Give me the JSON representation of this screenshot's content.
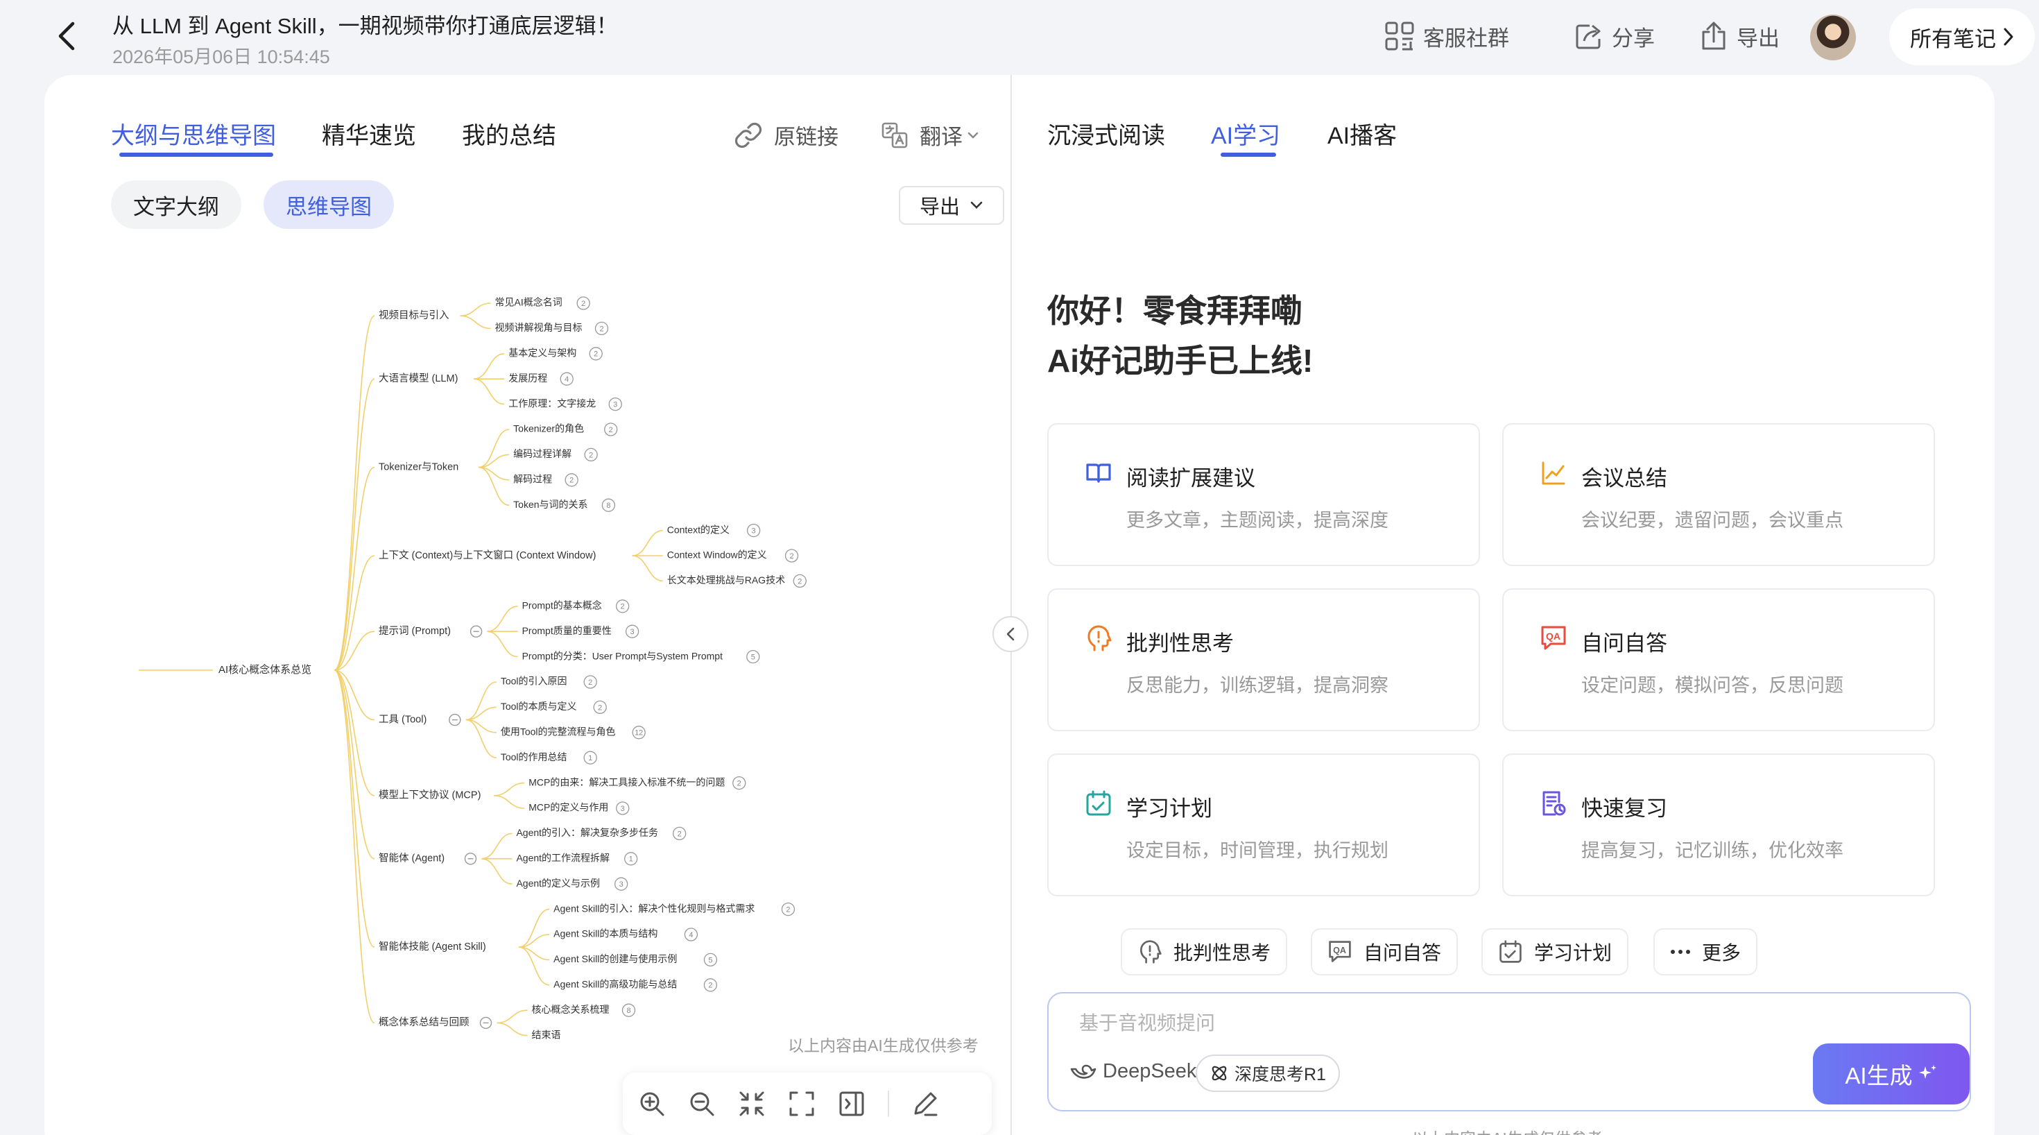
{
  "header": {
    "title": "从 LLM 到 Agent Skill，一期视频带你打通底层逻辑！",
    "datetime": "2026年05月06日 10:54:45",
    "community_label": "客服社群",
    "share_label": "分享",
    "export_label": "导出",
    "all_notes_label": "所有笔记",
    "icons": {
      "back": "chevron-left-icon",
      "community": "grid-icon",
      "share": "share-icon",
      "export": "upload-icon"
    }
  },
  "left": {
    "tabs": [
      {
        "label": "大纲与思维导图"
      },
      {
        "label": "精华速览"
      },
      {
        "label": "我的总结"
      }
    ],
    "link_label": "原链接",
    "translate_label": "翻译",
    "view_tabs": [
      {
        "label": "文字大纲"
      },
      {
        "label": "思维导图"
      }
    ],
    "export_label": "导出",
    "disclaimer": "以上内容由AI生成仅供参考",
    "mindmap": {
      "root": "AI核心概念体系总览",
      "branches": [
        {
          "label": "视频目标与引入",
          "children": [
            {
              "label": "常见AI概念名词",
              "n": "2"
            },
            {
              "label": "视频讲解视角与目标",
              "n": "2"
            }
          ]
        },
        {
          "label": "大语言模型 (LLM)",
          "children": [
            {
              "label": "基本定义与架构",
              "n": "2"
            },
            {
              "label": "发展历程",
              "n": "4"
            },
            {
              "label": "工作原理：文字接龙",
              "n": "3"
            }
          ]
        },
        {
          "label": "Tokenizer与Token",
          "children": [
            {
              "label": "Tokenizer的角色",
              "n": "2"
            },
            {
              "label": "编码过程详解",
              "n": "2"
            },
            {
              "label": "解码过程",
              "n": "2"
            },
            {
              "label": "Token与词的关系",
              "n": "8"
            }
          ]
        },
        {
          "label": "上下文 (Context)与上下文窗口 (Context Window)",
          "children": [
            {
              "label": "Context的定义",
              "n": "3"
            },
            {
              "label": "Context Window的定义",
              "n": "2"
            },
            {
              "label": "长文本处理挑战与RAG技术",
              "n": "2"
            }
          ]
        },
        {
          "label": "提示词 (Prompt)",
          "children": [
            {
              "label": "Prompt的基本概念",
              "n": "2"
            },
            {
              "label": "Prompt质量的重要性",
              "n": "3"
            },
            {
              "label": "Prompt的分类：User Prompt与System Prompt",
              "n": "5"
            }
          ]
        },
        {
          "label": "工具 (Tool)",
          "children": [
            {
              "label": "Tool的引入原因",
              "n": "2"
            },
            {
              "label": "Tool的本质与定义",
              "n": "2"
            },
            {
              "label": "使用Tool的完整流程与角色",
              "n": "12"
            },
            {
              "label": "Tool的作用总结",
              "n": "1"
            }
          ]
        },
        {
          "label": "模型上下文协议 (MCP)",
          "children": [
            {
              "label": "MCP的由来：解决工具接入标准不统一的问题",
              "n": "2"
            },
            {
              "label": "MCP的定义与作用",
              "n": "3"
            }
          ]
        },
        {
          "label": "智能体 (Agent)",
          "children": [
            {
              "label": "Agent的引入：解决复杂多步任务",
              "n": "2"
            },
            {
              "label": "Agent的工作流程拆解",
              "n": "1"
            },
            {
              "label": "Agent的定义与示例",
              "n": "3"
            }
          ]
        },
        {
          "label": "智能体技能 (Agent Skill)",
          "children": [
            {
              "label": "Agent Skill的引入：解决个性化规则与格式需求",
              "n": "2"
            },
            {
              "label": "Agent Skill的本质与结构",
              "n": "4"
            },
            {
              "label": "Agent Skill的创建与使用示例",
              "n": "5"
            },
            {
              "label": "Agent Skill的高级功能与总结",
              "n": "2"
            }
          ]
        },
        {
          "label": "概念体系总结与回顾",
          "children": [
            {
              "label": "核心概念关系梳理",
              "n": "8"
            },
            {
              "label": "结束语",
              "n": ""
            }
          ]
        }
      ]
    },
    "toolbar": [
      "zoom-in-icon",
      "zoom-out-icon",
      "fit-icon",
      "fullscreen-icon",
      "split-panel-icon",
      "edit-icon"
    ]
  },
  "right": {
    "tabs": [
      {
        "label": "沉浸式阅读"
      },
      {
        "label": "AI学习"
      },
      {
        "label": "AI播客"
      }
    ],
    "greeting_line1": "你好！零食拜拜嘞",
    "greeting_line2": "Ai好记助手已上线!",
    "features": [
      {
        "title": "阅读扩展建议",
        "desc": "更多文章，主题阅读，提高深度",
        "icon": "book-icon",
        "color": "#3f5fe0"
      },
      {
        "title": "会议总结",
        "desc": "会议纪要，遗留问题，会议重点",
        "icon": "chart-line-icon",
        "color": "#f0a020"
      },
      {
        "title": "批判性思考",
        "desc": "反思能力，训练逻辑，提高洞察",
        "icon": "head-exclaim-icon",
        "color": "#f07a20"
      },
      {
        "title": "自问自答",
        "desc": "设定问题，模拟问答，反思问题",
        "icon": "qa-icon",
        "color": "#e84c3d"
      },
      {
        "title": "学习计划",
        "desc": "设定目标，时间管理，执行规划",
        "icon": "calendar-check-icon",
        "color": "#22a6a0"
      },
      {
        "title": "快速复习",
        "desc": "提高复习，记忆训练，优化效率",
        "icon": "review-doc-icon",
        "color": "#6a55e0"
      }
    ],
    "chips": [
      {
        "label": "批判性思考",
        "icon": "head-exclaim-icon"
      },
      {
        "label": "自问自答",
        "icon": "qa-icon"
      },
      {
        "label": "学习计划",
        "icon": "calendar-check-icon"
      },
      {
        "label": "更多",
        "icon": "more-icon"
      }
    ],
    "ask": {
      "placeholder": "基于音视频提问",
      "model_label": "DeepSeek",
      "deep_think_label": "深度思考R1",
      "generate_label": "AI生成"
    },
    "disclaimer": "以上内容由AI生成仅供参考"
  }
}
